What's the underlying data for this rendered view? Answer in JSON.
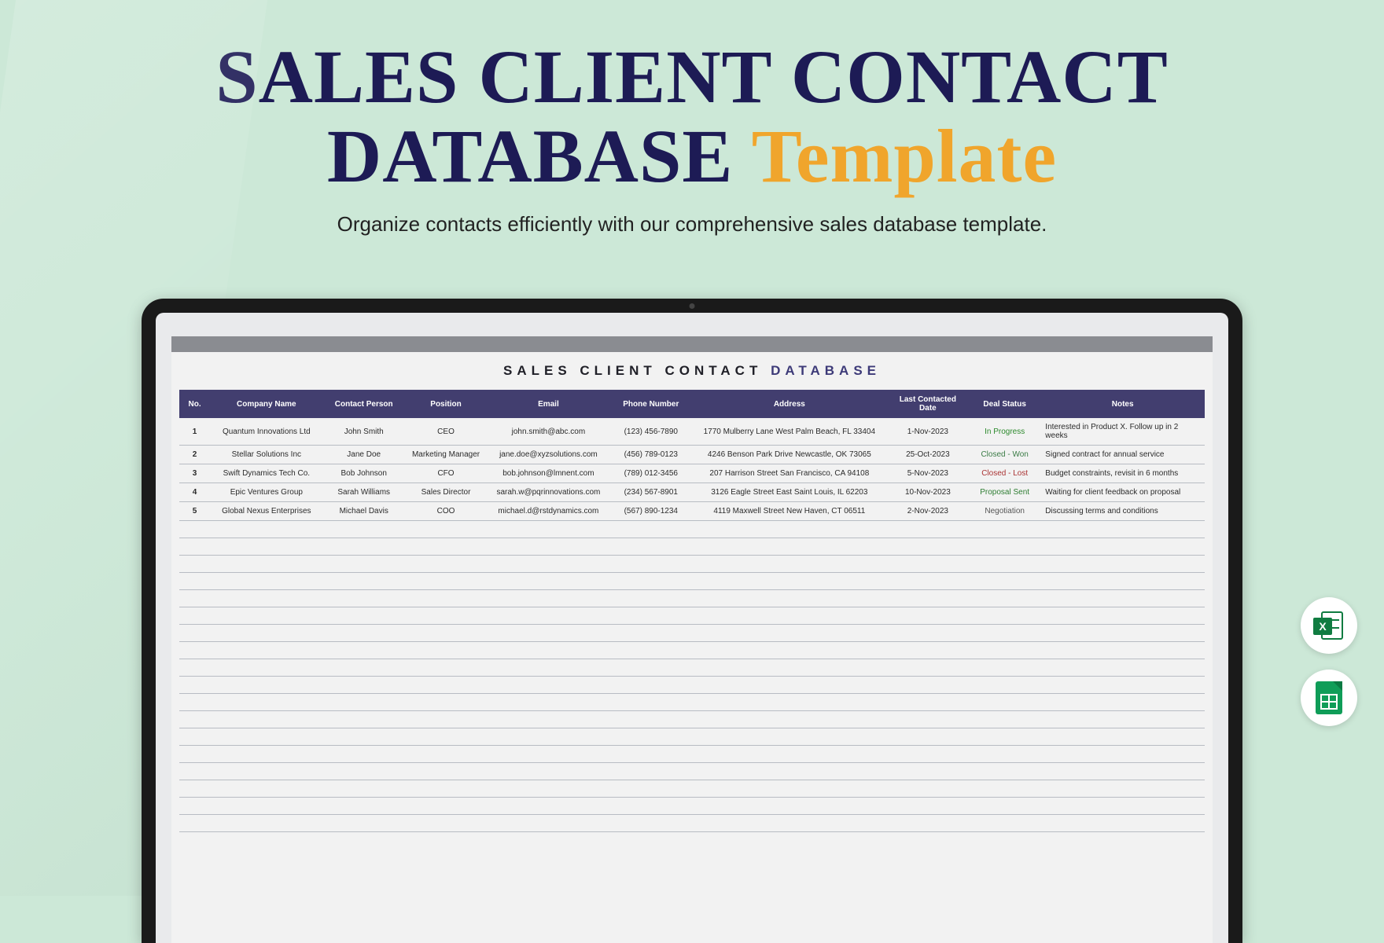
{
  "header": {
    "title_line1": "SALES CLIENT CONTACT",
    "title_line2_a": "DATABASE",
    "title_line2_b": "Template",
    "subtitle": "Organize contacts efficiently with our comprehensive sales database template."
  },
  "document": {
    "title_prefix": "SALES CLIENT CONTACT",
    "title_suffix": "DATABASE"
  },
  "columns": [
    "No.",
    "Company Name",
    "Contact Person",
    "Position",
    "Email",
    "Phone Number",
    "Address",
    "Last Contacted Date",
    "Deal Status",
    "Notes"
  ],
  "rows": [
    {
      "no": "1",
      "company": "Quantum Innovations Ltd",
      "contact": "John Smith",
      "position": "CEO",
      "email": "john.smith@abc.com",
      "phone": "(123) 456-7890",
      "address": "1770 Mulberry Lane West Palm Beach, FL 33404",
      "date": "1-Nov-2023",
      "status": "In Progress",
      "status_class": "status-progress",
      "notes": "Interested in Product X. Follow up in 2 weeks"
    },
    {
      "no": "2",
      "company": "Stellar Solutions Inc",
      "contact": "Jane Doe",
      "position": "Marketing Manager",
      "email": "jane.doe@xyzsolutions.com",
      "phone": "(456) 789-0123",
      "address": "4246 Benson Park Drive Newcastle, OK 73065",
      "date": "25-Oct-2023",
      "status": "Closed - Won",
      "status_class": "status-won",
      "notes": "Signed contract for annual service"
    },
    {
      "no": "3",
      "company": "Swift Dynamics Tech Co.",
      "contact": "Bob Johnson",
      "position": "CFO",
      "email": "bob.johnson@lmnent.com",
      "phone": "(789) 012-3456",
      "address": "207 Harrison Street San Francisco, CA 94108",
      "date": "5-Nov-2023",
      "status": "Closed - Lost",
      "status_class": "status-lost",
      "notes": "Budget constraints, revisit in 6 months"
    },
    {
      "no": "4",
      "company": "Epic Ventures Group",
      "contact": "Sarah Williams",
      "position": "Sales Director",
      "email": "sarah.w@pqrinnovations.com",
      "phone": "(234) 567-8901",
      "address": "3126 Eagle Street East Saint Louis, IL 62203",
      "date": "10-Nov-2023",
      "status": "Proposal Sent",
      "status_class": "status-proposal",
      "notes": "Waiting for client feedback on proposal"
    },
    {
      "no": "5",
      "company": "Global Nexus Enterprises",
      "contact": "Michael Davis",
      "position": "COO",
      "email": "michael.d@rstdynamics.com",
      "phone": "(567) 890-1234",
      "address": "4119 Maxwell Street New Haven, CT 06511",
      "date": "2-Nov-2023",
      "status": "Negotiation",
      "status_class": "status-neg",
      "notes": "Discussing terms and conditions"
    }
  ],
  "empty_rows": 18,
  "badges": {
    "excel_letter": "X"
  }
}
